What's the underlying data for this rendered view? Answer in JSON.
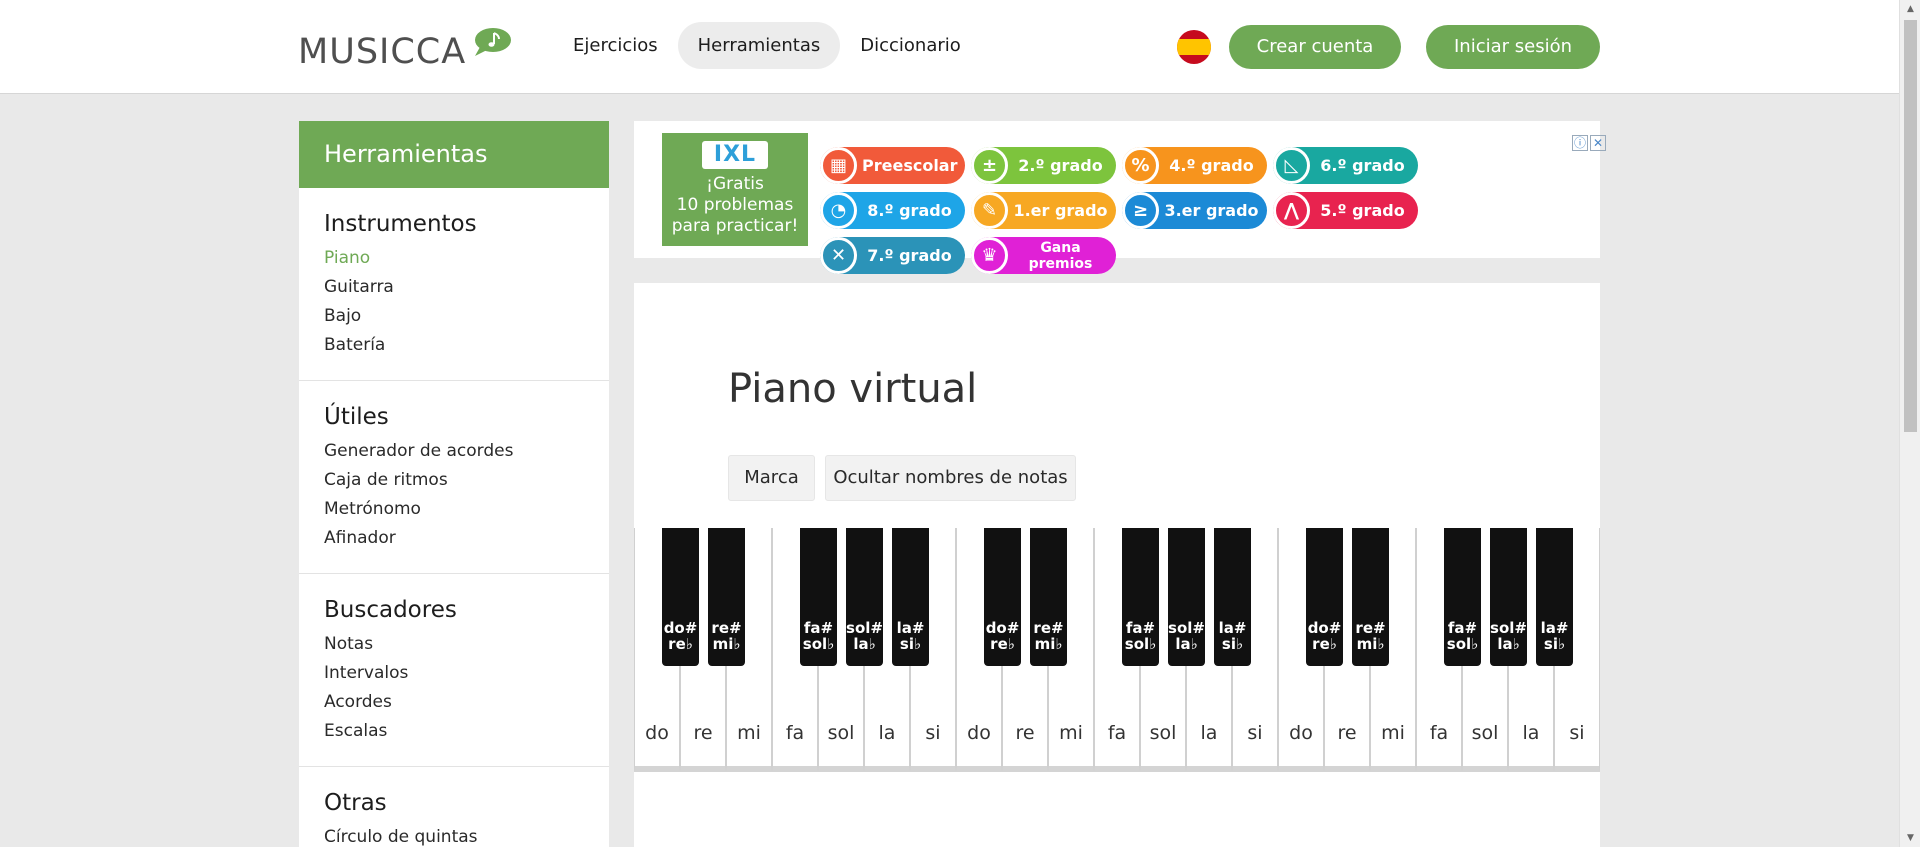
{
  "header": {
    "logo": "MUSICCA",
    "nav": [
      "Ejercicios",
      "Herramientas",
      "Diccionario"
    ],
    "nav_active": "Herramientas",
    "flag_icon": "spain-flag-icon",
    "create_account": "Crear cuenta",
    "login": "Iniciar sesión"
  },
  "sidebar": {
    "title": "Herramientas",
    "groups": [
      {
        "title": "Instrumentos",
        "items": [
          "Piano",
          "Guitarra",
          "Bajo",
          "Batería"
        ]
      },
      {
        "title": "Útiles",
        "items": [
          "Generador de acordes",
          "Caja de ritmos",
          "Metrónomo",
          "Afinador"
        ]
      },
      {
        "title": "Buscadores",
        "items": [
          "Notas",
          "Intervalos",
          "Acordes",
          "Escalas"
        ]
      },
      {
        "title": "Otras",
        "items": [
          "Círculo de quintas"
        ]
      }
    ],
    "active_item": "Piano"
  },
  "ad": {
    "brand": "IXL",
    "line1": "¡Gratis",
    "line2": "10 problemas",
    "line3": "para practicar!",
    "pills": [
      {
        "label": "Preescolar",
        "color": "#f15a3a",
        "icon": "abacus-icon"
      },
      {
        "label": "2.º grado",
        "color": "#7dc43d",
        "icon": "plus-minus-icon"
      },
      {
        "label": "4.º grado",
        "color": "#f7941d",
        "icon": "percent-icon"
      },
      {
        "label": "6.º grado",
        "color": "#19a8a0",
        "icon": "triangle-ruler-icon"
      },
      {
        "label": "8.º grado",
        "color": "#1ea5e7",
        "icon": "pie-chart-icon"
      },
      {
        "label": "1.er grado",
        "color": "#f7a823",
        "icon": "pencil-cup-icon"
      },
      {
        "label": "3.er grado",
        "color": "#1c8ad6",
        "icon": "greater-equal-icon"
      },
      {
        "label": "5.º grado",
        "color": "#e8234f",
        "icon": "compass-icon"
      },
      {
        "label": "7.º grado",
        "color": "#2b93b8",
        "icon": "satellite-icon"
      },
      {
        "label": "Gana premios",
        "color": "#e021d6",
        "icon": "trophy-icon"
      }
    ],
    "info": "ⓘ",
    "close": "✕"
  },
  "main": {
    "title": "Piano virtual",
    "btn_mark": "Marca",
    "btn_hide": "Ocultar nombres de notas"
  },
  "piano": {
    "white_keys": [
      "do",
      "re",
      "mi",
      "fa",
      "sol",
      "la",
      "si",
      "do",
      "re",
      "mi",
      "fa",
      "sol",
      "la",
      "si",
      "do",
      "re",
      "mi",
      "fa",
      "sol",
      "la",
      "si"
    ],
    "black_keys": [
      {
        "top": "do#",
        "bottom": "re♭"
      },
      {
        "top": "re#",
        "bottom": "mi♭"
      },
      {
        "top": "fa#",
        "bottom": "sol♭"
      },
      {
        "top": "sol#",
        "bottom": "la♭"
      },
      {
        "top": "la#",
        "bottom": "si♭"
      },
      {
        "top": "do#",
        "bottom": "re♭"
      },
      {
        "top": "re#",
        "bottom": "mi♭"
      },
      {
        "top": "fa#",
        "bottom": "sol♭"
      },
      {
        "top": "sol#",
        "bottom": "la♭"
      },
      {
        "top": "la#",
        "bottom": "si♭"
      },
      {
        "top": "do#",
        "bottom": "re♭"
      },
      {
        "top": "re#",
        "bottom": "mi♭"
      },
      {
        "top": "fa#",
        "bottom": "sol♭"
      },
      {
        "top": "sol#",
        "bottom": "la♭"
      },
      {
        "top": "la#",
        "bottom": "si♭"
      }
    ]
  }
}
